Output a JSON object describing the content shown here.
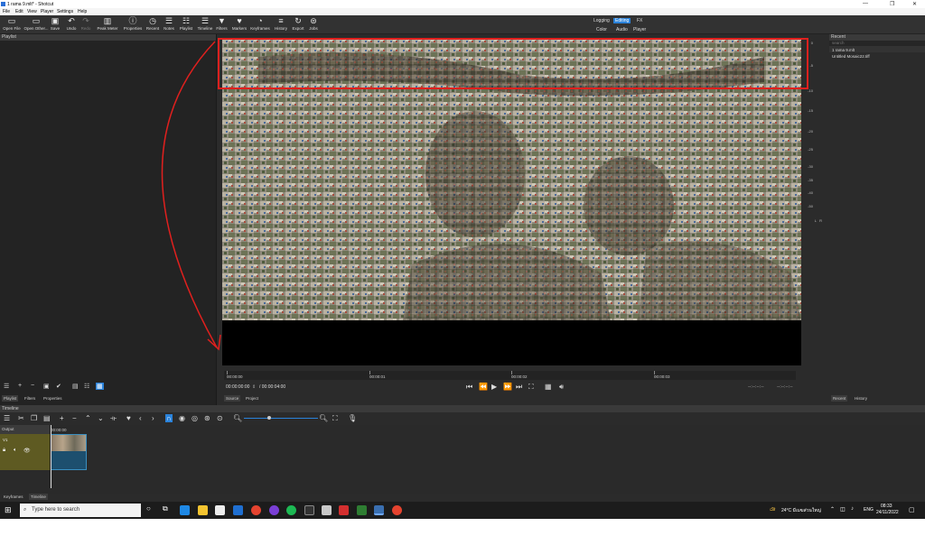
{
  "window": {
    "title": "1 rama 9.mlt* - Shotcut"
  },
  "menu": [
    "File",
    "Edit",
    "View",
    "Player",
    "Settings",
    "Help"
  ],
  "toolbar": [
    {
      "label": "Open File",
      "icon": "open-file-icon"
    },
    {
      "label": "Open Other...",
      "icon": "open-other-icon"
    },
    {
      "label": "Save",
      "icon": "save-icon"
    },
    {
      "label": "Undo",
      "icon": "undo-icon"
    },
    {
      "label": "Redo",
      "icon": "redo-icon"
    },
    {
      "label": "Peak Meter",
      "icon": "peak-meter-icon"
    },
    {
      "label": "Properties",
      "icon": "properties-icon"
    },
    {
      "label": "Recent",
      "icon": "recent-icon"
    },
    {
      "label": "Notes",
      "icon": "notes-icon"
    },
    {
      "label": "Playlist",
      "icon": "playlist-icon"
    },
    {
      "label": "Timeline",
      "icon": "timeline-icon"
    },
    {
      "label": "Filters",
      "icon": "filters-icon"
    },
    {
      "label": "Markers",
      "icon": "markers-icon"
    },
    {
      "label": "Keyframes",
      "icon": "keyframes-icon"
    },
    {
      "label": "History",
      "icon": "history-icon"
    },
    {
      "label": "Export",
      "icon": "export-icon"
    },
    {
      "label": "Jobs",
      "icon": "jobs-icon"
    }
  ],
  "workspaces": {
    "row1": [
      "Logging",
      "Editing",
      "FX"
    ],
    "row2": [
      "Color",
      "Audio",
      "Player"
    ],
    "active": "Editing"
  },
  "left_panel": {
    "title": "Playlist",
    "tabs": [
      "Playlist",
      "Filters",
      "Properties"
    ]
  },
  "right_panel": {
    "title": "Recent",
    "search_placeholder": "search",
    "items": [
      "1 rama 9.mlt",
      "Untitled Mosaic22.tiff"
    ],
    "tabs": [
      "Recent",
      "History"
    ]
  },
  "player": {
    "ruler": [
      "00:00:00",
      "00:00:01",
      "00:00:02",
      "00:00:03"
    ],
    "current_time": "00:00:00:00",
    "duration": "/ 00:00:04:00",
    "in_point": "--:--:--:--",
    "out_point": "--:--:--:--",
    "tabs": [
      "Source",
      "Project"
    ],
    "meter_scale": [
      "0",
      "-5",
      "-10",
      "-15",
      "-20",
      "-25",
      "-30",
      "-35",
      "-40",
      "-50"
    ],
    "meter_channels": [
      "L",
      "R"
    ]
  },
  "timeline": {
    "title": "Timeline",
    "output_label": "Output",
    "track_label": "V1",
    "clip_time": "00:00:00"
  },
  "bottom_tabs": [
    "Keyframes",
    "Timeline"
  ],
  "taskbar": {
    "search_placeholder": "Type here to search",
    "weather": "24°C มีเมฆส่วนใหญ่",
    "lang": "ENG",
    "time": "08:33",
    "date": "24/11/2022"
  },
  "colors": {
    "accent": "#2a82da",
    "annotation": "#e0201e",
    "track": "#5e5a22"
  }
}
